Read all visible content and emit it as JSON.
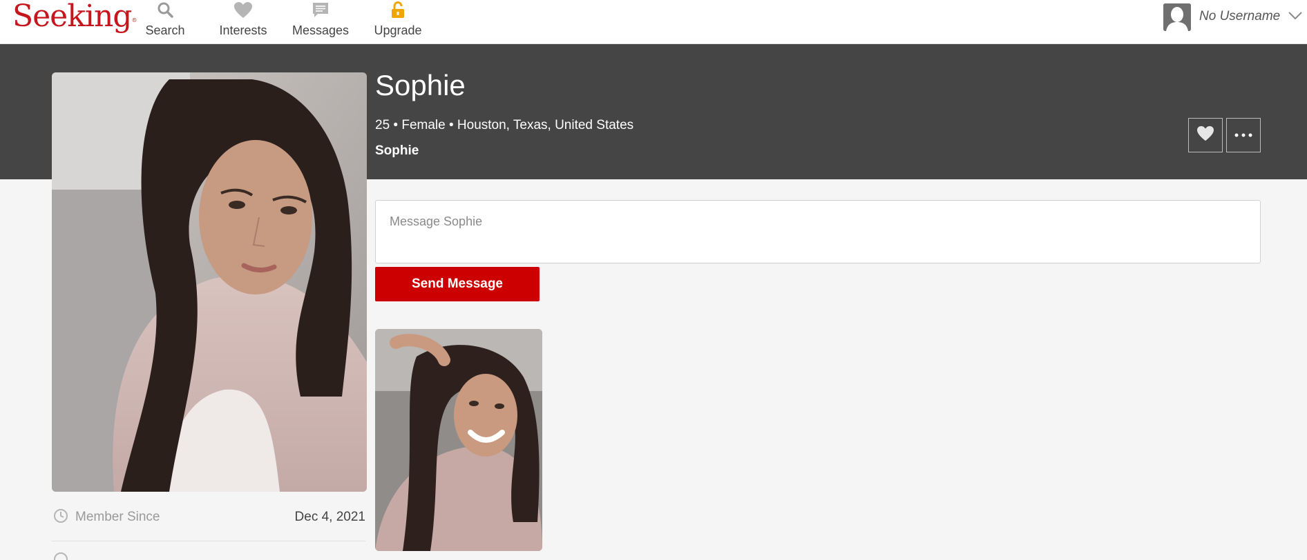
{
  "brand": {
    "logo_text": "Seeking",
    "logo_mark": "®",
    "accent_color": "#c4161c"
  },
  "nav": {
    "items": [
      {
        "label": "Search",
        "icon": "search-icon"
      },
      {
        "label": "Interests",
        "icon": "heart-icon"
      },
      {
        "label": "Messages",
        "icon": "message-icon"
      },
      {
        "label": "Upgrade",
        "icon": "lock-icon"
      }
    ],
    "user": {
      "name": "No Username",
      "icon": "avatar-silhouette"
    }
  },
  "profile": {
    "name": "Sophie",
    "meta": "25 • Female • Houston, Texas, United States",
    "username": "Sophie",
    "favorite_icon": "heart-icon",
    "more_icon": "ellipsis-icon"
  },
  "compose": {
    "placeholder": "Message Sophie",
    "value": "",
    "send_label": "Send Message",
    "send_color": "#cc0000"
  },
  "details": {
    "member_since_label": "Member Since",
    "member_since_value": "Dec 4, 2021"
  }
}
